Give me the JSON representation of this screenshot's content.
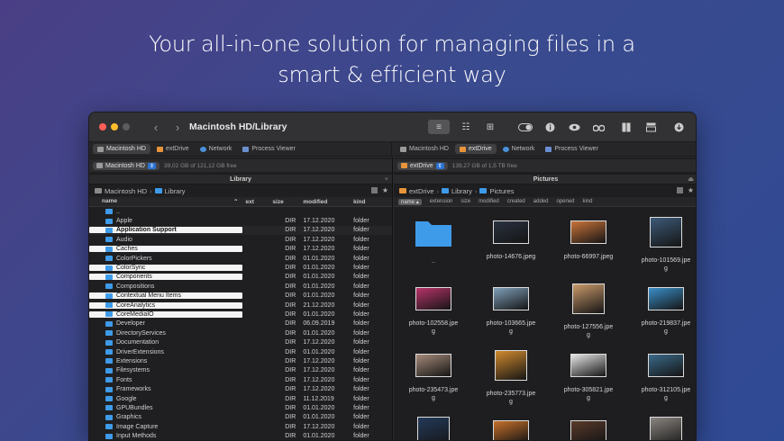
{
  "headline": {
    "line1": "Your all-in-one solution for managing files in a",
    "line2": "smart & efficient way"
  },
  "window": {
    "title": "Macintosh HD/Library",
    "nav_back": "‹",
    "nav_forward": "›"
  },
  "left_tabs": [
    {
      "label": "Macintosh HD",
      "icon": "drive-icon"
    },
    {
      "label": "extDrive",
      "icon": "orange-drive-icon"
    },
    {
      "label": "Network",
      "icon": "globe-icon"
    },
    {
      "label": "Process Viewer",
      "icon": "process-icon"
    }
  ],
  "right_tabs": [
    {
      "label": "Macintosh HD",
      "icon": "drive-icon"
    },
    {
      "label": "extDrive",
      "icon": "orange-drive-icon"
    },
    {
      "label": "Network",
      "icon": "globe-icon"
    },
    {
      "label": "Process Viewer",
      "icon": "process-icon"
    }
  ],
  "left": {
    "drive": "Macintosh HD",
    "free": "39,02 GB of 121,12 GB free",
    "title": "Library",
    "crumbs": [
      "Macintosh HD",
      "Library"
    ],
    "columns": [
      "name",
      "ext",
      "size",
      "modified",
      "kind"
    ],
    "rows": [
      {
        "name": "..",
        "size": "",
        "modified": "",
        "kind": ""
      },
      {
        "name": "Apple",
        "size": "DIR",
        "modified": "17.12.2020",
        "kind": "folder"
      },
      {
        "name": "Application Support",
        "size": "DIR",
        "modified": "17.12.2020",
        "kind": "folder"
      },
      {
        "name": "Audio",
        "size": "DIR",
        "modified": "17.12.2020",
        "kind": "folder"
      },
      {
        "name": "Caches",
        "size": "DIR",
        "modified": "17.12.2020",
        "kind": "folder"
      },
      {
        "name": "ColorPickers",
        "size": "DIR",
        "modified": "01.01.2020",
        "kind": "folder"
      },
      {
        "name": "ColorSync",
        "size": "DIR",
        "modified": "01.01.2020",
        "kind": "folder"
      },
      {
        "name": "Components",
        "size": "DIR",
        "modified": "01.01.2020",
        "kind": "folder"
      },
      {
        "name": "Compositions",
        "size": "DIR",
        "modified": "01.01.2020",
        "kind": "folder"
      },
      {
        "name": "Contextual Menu Items",
        "size": "DIR",
        "modified": "01.01.2020",
        "kind": "folder"
      },
      {
        "name": "CoreAnalytics",
        "size": "DIR",
        "modified": "21.12.2020",
        "kind": "folder"
      },
      {
        "name": "CoreMediaIO",
        "size": "DIR",
        "modified": "01.01.2020",
        "kind": "folder"
      },
      {
        "name": "Developer",
        "size": "DIR",
        "modified": "06.09.2019",
        "kind": "folder"
      },
      {
        "name": "DirectoryServices",
        "size": "DIR",
        "modified": "01.01.2020",
        "kind": "folder"
      },
      {
        "name": "Documentation",
        "size": "DIR",
        "modified": "17.12.2020",
        "kind": "folder"
      },
      {
        "name": "DriverExtensions",
        "size": "DIR",
        "modified": "01.01.2020",
        "kind": "folder"
      },
      {
        "name": "Extensions",
        "size": "DIR",
        "modified": "17.12.2020",
        "kind": "folder"
      },
      {
        "name": "Filesystems",
        "size": "DIR",
        "modified": "17.12.2020",
        "kind": "folder"
      },
      {
        "name": "Fonts",
        "size": "DIR",
        "modified": "17.12.2020",
        "kind": "folder"
      },
      {
        "name": "Frameworks",
        "size": "DIR",
        "modified": "17.12.2020",
        "kind": "folder"
      },
      {
        "name": "Google",
        "size": "DIR",
        "modified": "11.12.2019",
        "kind": "folder"
      },
      {
        "name": "GPUBundles",
        "size": "DIR",
        "modified": "01.01.2020",
        "kind": "folder"
      },
      {
        "name": "Graphics",
        "size": "DIR",
        "modified": "01.01.2020",
        "kind": "folder"
      },
      {
        "name": "Image Capture",
        "size": "DIR",
        "modified": "17.12.2020",
        "kind": "folder"
      },
      {
        "name": "Input Methods",
        "size": "DIR",
        "modified": "01.01.2020",
        "kind": "folder"
      }
    ]
  },
  "right": {
    "drive": "extDrive",
    "free": "139,27 GB of 1,5 TB free",
    "title": "Pictures",
    "crumbs": [
      "extDrive",
      "Library",
      "Pictures"
    ],
    "columns": [
      "name",
      "extension",
      "size",
      "modified",
      "created",
      "added",
      "opened",
      "kind"
    ],
    "items": [
      {
        "l1": "..",
        "l2": "",
        "color": "#3e9bea",
        "kind": "folder"
      },
      {
        "l1": "photo-14676.jpeg",
        "l2": "",
        "color": "#2a3240"
      },
      {
        "l1": "photo-66997.jpeg",
        "l2": "",
        "color": "#c9743a"
      },
      {
        "l1": "photo-101569.jpe",
        "l2": "g",
        "color": "#3d5a78"
      },
      {
        "l1": "photo-102558.jpe",
        "l2": "g",
        "color": "#b8336a"
      },
      {
        "l1": "photo-103665.jpe",
        "l2": "g",
        "color": "#7f9fb8"
      },
      {
        "l1": "photo-127556.jpe",
        "l2": "g",
        "color": "#c99a6a"
      },
      {
        "l1": "photo-219837.jpe",
        "l2": "g",
        "color": "#3a8fc8"
      },
      {
        "l1": "photo-235473.jpe",
        "l2": "g",
        "color": "#a58a7a"
      },
      {
        "l1": "photo-235773.jpe",
        "l2": "g",
        "color": "#d08a2e"
      },
      {
        "l1": "photo-305821.jpe",
        "l2": "g",
        "color": "#e6e6e6"
      },
      {
        "l1": "photo-312105.jpe",
        "l2": "g",
        "color": "#3a6a8a"
      },
      {
        "l1": "",
        "l2": "",
        "color": "#233a5a"
      },
      {
        "l1": "",
        "l2": "",
        "color": "#c6702a"
      },
      {
        "l1": "",
        "l2": "",
        "color": "#5a3a2a"
      },
      {
        "l1": "",
        "l2": "",
        "color": "#8a8580"
      }
    ]
  },
  "colors": {
    "accent": "#2b74d6",
    "folder": "#3e9bea"
  }
}
